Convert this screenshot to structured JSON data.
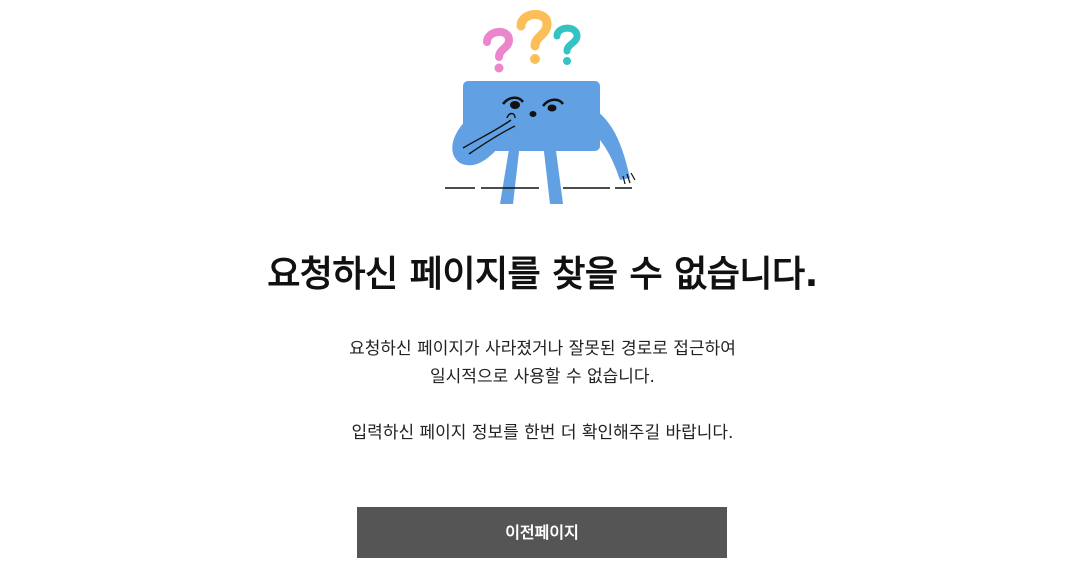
{
  "error": {
    "title": "요청하신 페이지를 찾을 수 없습니다.",
    "description_line_1": "요청하신 페이지가 사라졌거나 잘못된 경로로 접근하여",
    "description_line_2": "일시적으로 사용할 수 없습니다.",
    "description_line_3": "입력하신 페이지 정보를 한번 더 확인해주길 바랍니다."
  },
  "actions": {
    "prev_page_label": "이전페이지"
  },
  "illustration": {
    "icon": "confused-character-icon",
    "colors": {
      "body": "#61A0E3",
      "question_pink": "#EB86CC",
      "question_orange": "#FBBE58",
      "question_teal": "#34C3C3"
    }
  }
}
